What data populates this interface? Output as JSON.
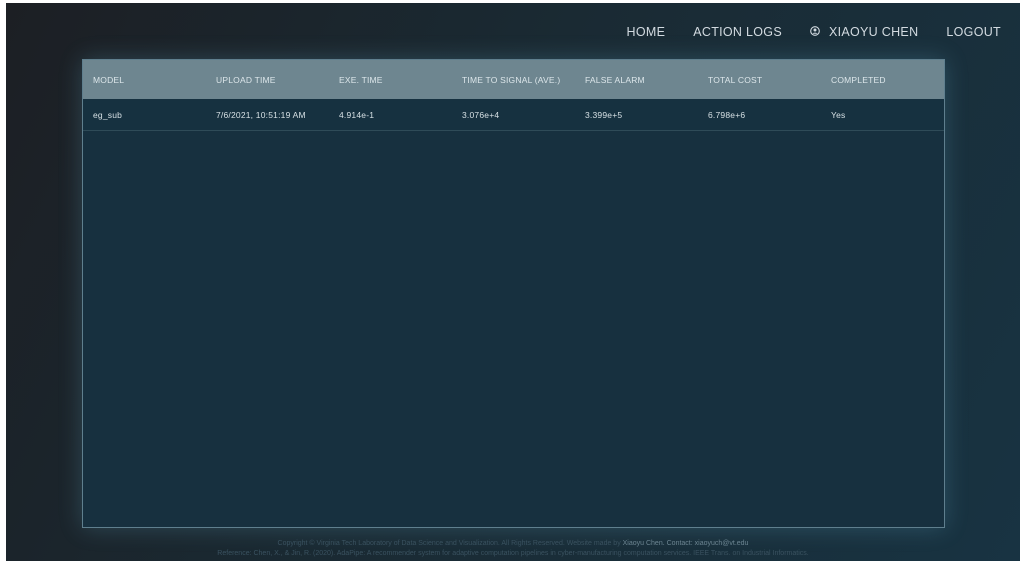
{
  "nav": {
    "home": "HOME",
    "action_logs": "ACTION LOGS",
    "user_name": "XIAOYU CHEN",
    "logout": "LOGOUT",
    "user_icon": "user-circle-icon"
  },
  "table": {
    "columns": [
      "MODEL",
      "UPLOAD TIME",
      "EXE. TIME",
      "TIME TO SIGNAL (AVE.)",
      "FALSE ALARM",
      "TOTAL COST",
      "COMPLETED"
    ],
    "rows": [
      [
        "eg_sub",
        "7/6/2021, 10:51:19 AM",
        "4.914e-1",
        "3.076e+4",
        "3.399e+5",
        "6.798e+6",
        "Yes"
      ]
    ]
  },
  "footer": {
    "line1_prefix": "Copyright © Virginia Tech Laboratory of Data Science and Visualization. All Rights Reserved. Website made by ",
    "line1_author": "Xiaoyu Chen",
    "line1_contact": ". Contact: xiaoyuch@vt.edu",
    "line2": "Reference: Chen, X., & Jin, R. (2020). AdaPipe: A recommender system for adaptive computation pipelines in cyber-manufacturing computation services. IEEE Trans. on Industrial Informatics."
  }
}
